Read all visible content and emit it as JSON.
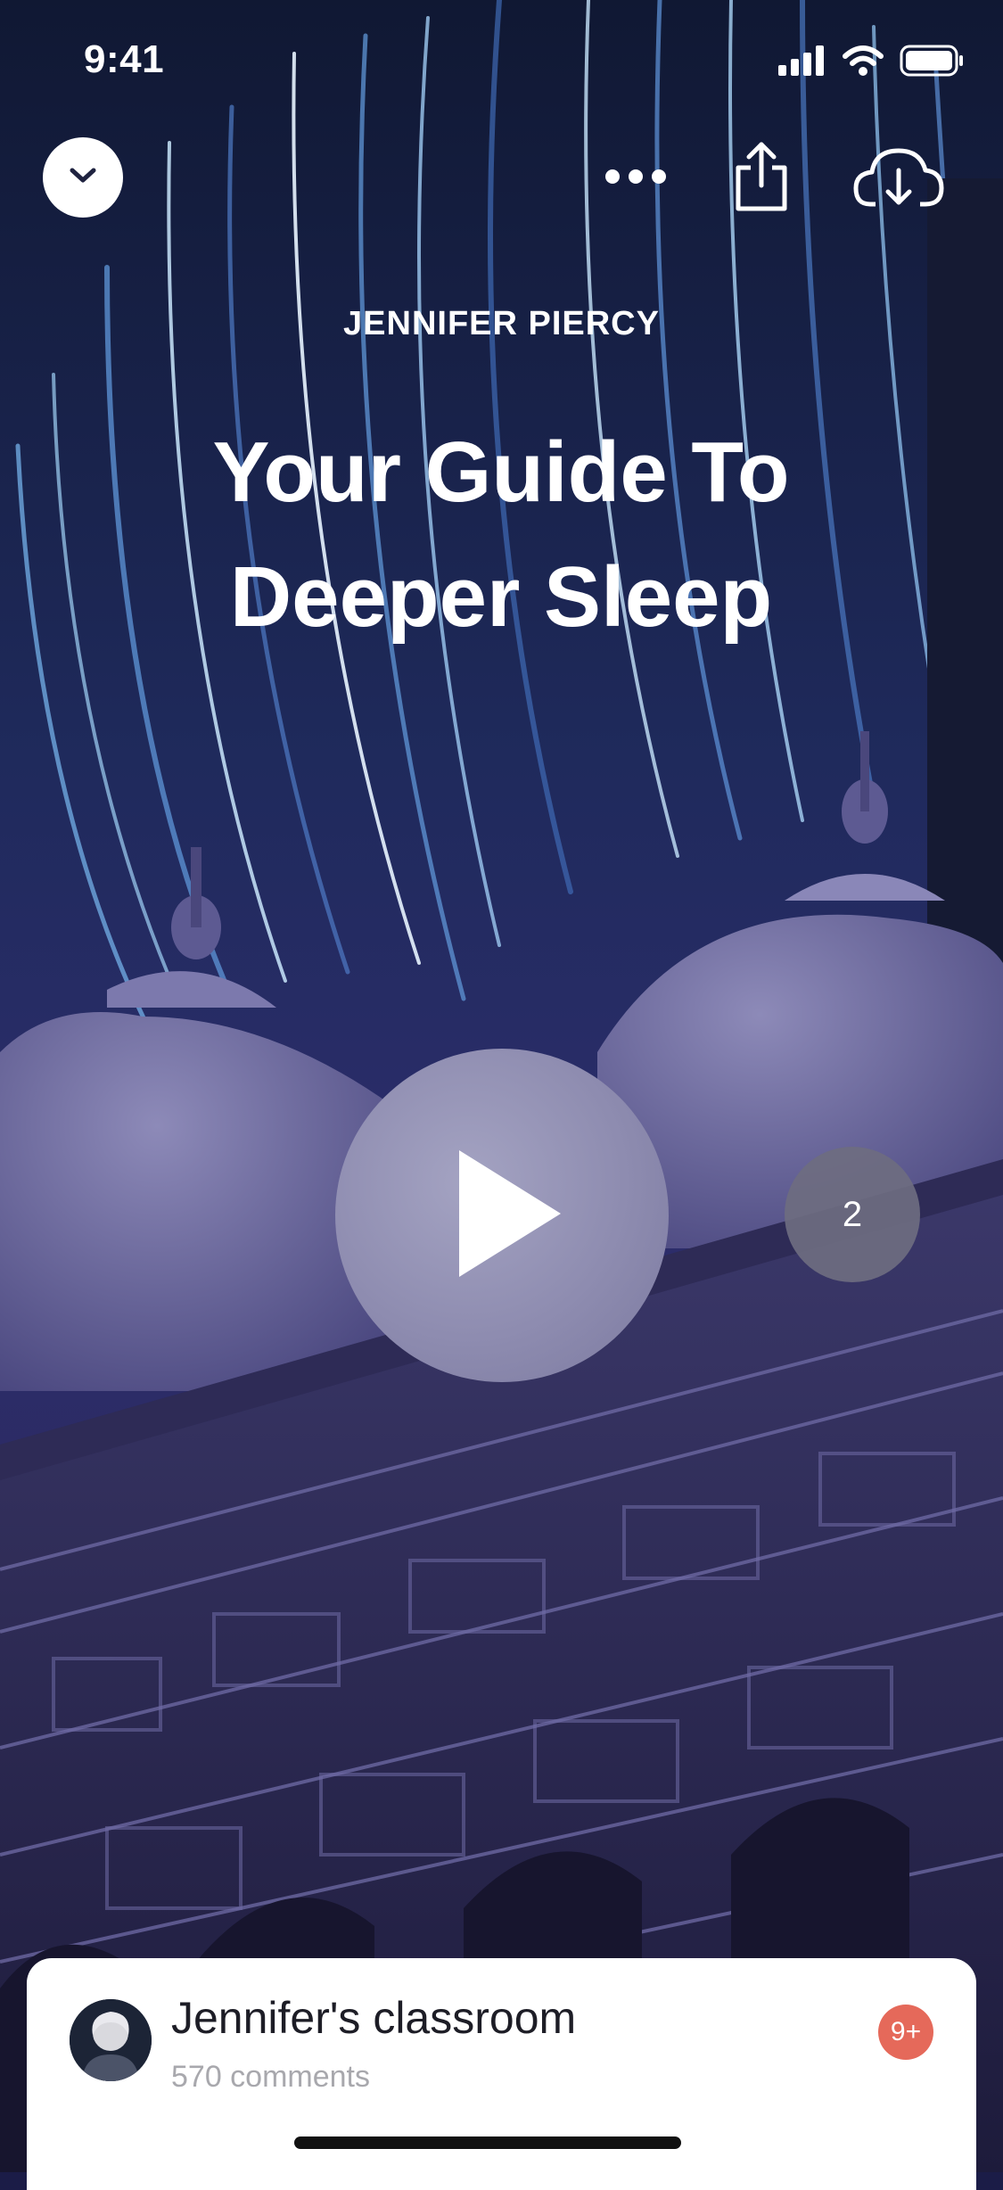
{
  "status_bar": {
    "time": "9:41",
    "icons": [
      "signal-icon",
      "wifi-icon",
      "battery-icon"
    ]
  },
  "toolbar": {
    "icons": [
      "chevron-down-icon",
      "more-icon",
      "share-icon",
      "cloud-download-icon"
    ]
  },
  "session": {
    "author": "JENNIFER PIERCY",
    "title": "Your Guide To Deeper Sleep"
  },
  "player": {
    "play_icon": "play-icon",
    "count_badge": "2"
  },
  "classroom": {
    "title": "Jennifer's classroom",
    "comments": "570 comments",
    "badge": "9+"
  },
  "colors": {
    "sky": "#1b1c47",
    "dome": "#6a679c",
    "badge_red": "#e5695a",
    "card_bg": "#ffffff"
  }
}
